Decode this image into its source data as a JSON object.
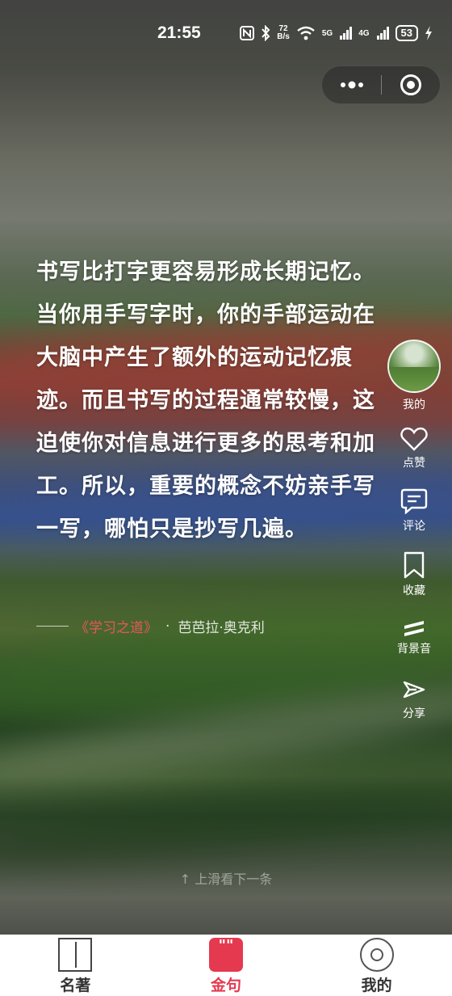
{
  "status_bar": {
    "time": "21:55",
    "net_speed_value": "72",
    "net_speed_unit": "B/s",
    "signal_5g": "5G",
    "signal_4g": "4G",
    "battery": "53"
  },
  "quote": {
    "text": "书写比打字更容易形成长期记忆。当你用手写字时，你的手部运动在大脑中产生了额外的运动记忆痕迹。而且书写的过程通常较慢，这迫使你对信息进行更多的思考和加工。所以，重要的概念不妨亲手写一写，哪怕只是抄写几遍。",
    "book": "《学习之道》",
    "separator": "·",
    "author": "芭芭拉·奥克利"
  },
  "side_actions": {
    "me_label": "我的",
    "like_label": "点赞",
    "comment_label": "评论",
    "favorite_label": "收藏",
    "music_label": "背景音",
    "share_label": "分享"
  },
  "hint": "↑ 上滑看下一条",
  "tabs": {
    "classics": "名著",
    "quotes": "金句",
    "quotes_icon": "\"\"",
    "mine": "我的"
  },
  "colors": {
    "accent": "#e4394f",
    "book_title": "#e45856"
  },
  "icons": [
    "nfc-icon",
    "bluetooth-icon",
    "wifi-icon",
    "signal-icon",
    "battery-icon",
    "charging-icon",
    "more-dots-icon",
    "close-target-icon",
    "heart-icon",
    "comment-icon",
    "bookmark-icon",
    "music-icon",
    "share-icon",
    "book-icon",
    "quote-icon",
    "profile-icon"
  ]
}
